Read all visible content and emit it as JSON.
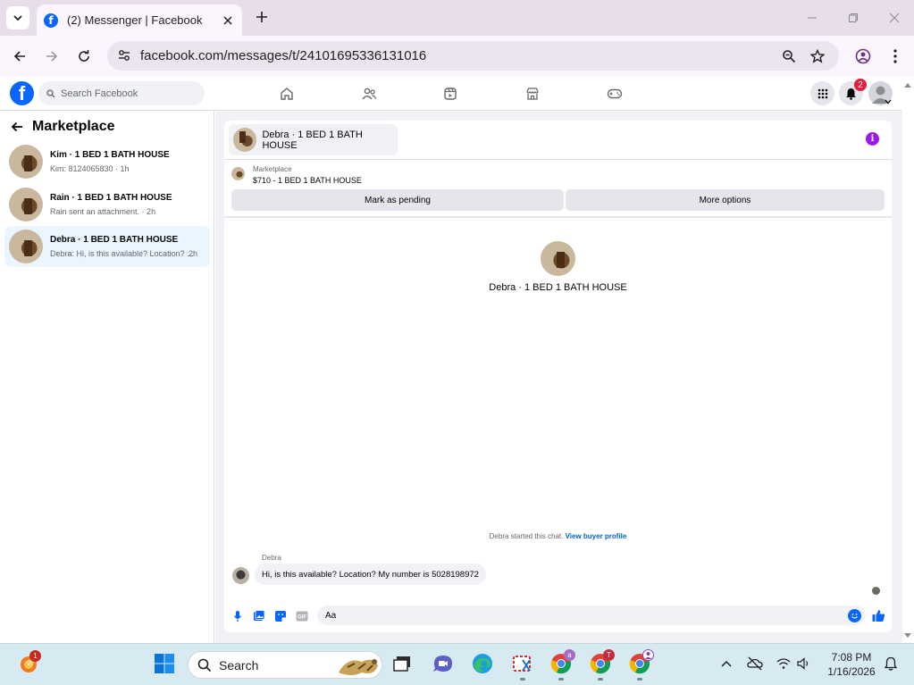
{
  "browser": {
    "tab_title": "(2) Messenger | Facebook",
    "url": "facebook.com/messages/t/24101695336131016"
  },
  "fb": {
    "search_placeholder": "Search Facebook",
    "notifications_count": "2"
  },
  "sidebar": {
    "title": "Marketplace",
    "conversations": [
      {
        "name": "Kim · 1 BED 1 BATH HOUSE",
        "snippet": "Kim: 8124065830 · 1h",
        "time": ""
      },
      {
        "name": "Rain · 1 BED 1 BATH HOUSE",
        "snippet": "Rain sent an attachment. · 2h",
        "time": ""
      },
      {
        "name": "Debra · 1 BED 1 BATH HOUSE",
        "snippet": "Debra: Hi, is this available? Location? ...",
        "time": "2h"
      }
    ]
  },
  "chat": {
    "header_name": "Debra · 1 BED 1 BATH HOUSE",
    "marketplace_label": "Marketplace",
    "listing": "$710 - 1 BED 1 BATH HOUSE",
    "mark_pending": "Mark as pending",
    "more_options": "More options",
    "profile_name": "Debra · 1 BED 1 BATH HOUSE",
    "started_text": "Debra started this chat.",
    "buyer_profile_link": "View buyer profile",
    "sender": "Debra",
    "message": "Hi, is this available? Location? My number is 5028198972",
    "composer_placeholder": "Aa"
  },
  "taskbar": {
    "search_label": "Search",
    "time": "7:08 PM",
    "date": "1/16/2026",
    "app_badges": {
      "outlook": "1",
      "chrome_a": "a",
      "chrome_t": "T"
    }
  }
}
